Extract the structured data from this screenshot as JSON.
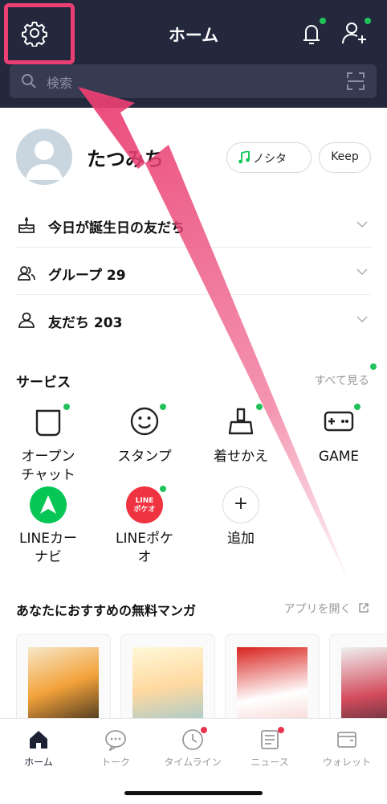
{
  "header": {
    "title": "ホーム"
  },
  "search": {
    "placeholder": "検索"
  },
  "profile": {
    "name": "たつみち",
    "music_label": "ノシタ",
    "keep_label": "Keep"
  },
  "rows": [
    {
      "label": "今日が誕生日の友だち",
      "icon": "cake-icon"
    },
    {
      "label": "グループ 29",
      "icon": "group-icon"
    },
    {
      "label": "友だち 203",
      "icon": "person-icon"
    }
  ],
  "services": {
    "title": "サービス",
    "see_all": "すべて見る",
    "items": [
      {
        "label": "オープン\nチャット",
        "icon": "open-chat-icon"
      },
      {
        "label": "スタンプ",
        "icon": "sticker-icon"
      },
      {
        "label": "着せかえ",
        "icon": "theme-brush-icon"
      },
      {
        "label": "GAME",
        "icon": "gamepad-icon"
      },
      {
        "label": "LINEカー\nナビ",
        "icon": "line-car-navi-icon"
      },
      {
        "label": "LINEポケ\nオ",
        "icon": "line-pokeo-icon",
        "badge": "LINE ポケオ"
      },
      {
        "label": "追加",
        "icon": "plus-icon"
      }
    ]
  },
  "manga": {
    "title": "あなたにおすすめの無料マンガ",
    "open_app": "アプリを開く"
  },
  "tabs": [
    {
      "label": "ホーム",
      "icon": "home-icon"
    },
    {
      "label": "トーク",
      "icon": "chat-icon"
    },
    {
      "label": "タイムライン",
      "icon": "clock-icon"
    },
    {
      "label": "ニュース",
      "icon": "news-icon"
    },
    {
      "label": "ウォレット",
      "icon": "wallet-icon"
    }
  ],
  "colors": {
    "header_bg": "#23283d",
    "highlight": "#ea3f72",
    "badge_green": "#22c25a",
    "badge_red": "#e8344e",
    "line_green": "#06c755"
  }
}
